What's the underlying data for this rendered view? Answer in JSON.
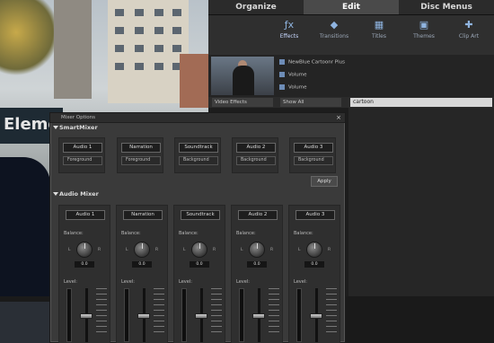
{
  "tabs": [
    "Organize",
    "Edit",
    "Disc Menus"
  ],
  "active_tab": "Edit",
  "tools": [
    {
      "label": "Effects",
      "icon": "effects-icon",
      "selected": true
    },
    {
      "label": "Transitions",
      "icon": "transitions-icon",
      "selected": false
    },
    {
      "label": "Titles",
      "icon": "titles-icon",
      "selected": false
    },
    {
      "label": "Themes",
      "icon": "themes-icon",
      "selected": false
    },
    {
      "label": "Clip Art",
      "icon": "clip-art-icon",
      "selected": false
    }
  ],
  "effects_list": [
    "NewBlue Cartoonr Plus",
    "Volume",
    "Volume"
  ],
  "filter": {
    "category": "Video Effects",
    "scope": "Show All",
    "search": "cartoon"
  },
  "video_sign_text": "Eleme",
  "mixer": {
    "title": "Mixer Options",
    "close": "×",
    "smartmixer_label": "SmartMixer",
    "audiomixer_label": "Audio Mixer",
    "apply_label": "Apply",
    "balance_label": "Balance:",
    "level_label": "Level:",
    "left_mark": "L",
    "right_mark": "R",
    "smart_channels": [
      {
        "name": "Audio 1",
        "mode": "Foreground"
      },
      {
        "name": "Narration",
        "mode": "Foreground"
      },
      {
        "name": "Soundtrack",
        "mode": "Background"
      },
      {
        "name": "Audio 2",
        "mode": "Background"
      },
      {
        "name": "Audio 3",
        "mode": "Background"
      }
    ],
    "audio_channels": [
      {
        "name": "Audio 1",
        "balance": "0.0"
      },
      {
        "name": "Narration",
        "balance": "0.0"
      },
      {
        "name": "Soundtrack",
        "balance": "0.0"
      },
      {
        "name": "Audio 2",
        "balance": "0.0"
      },
      {
        "name": "Audio 3",
        "balance": "0.0"
      }
    ]
  },
  "colors": {
    "accent": "#8fb4e0",
    "panel": "#3a3a3a"
  }
}
